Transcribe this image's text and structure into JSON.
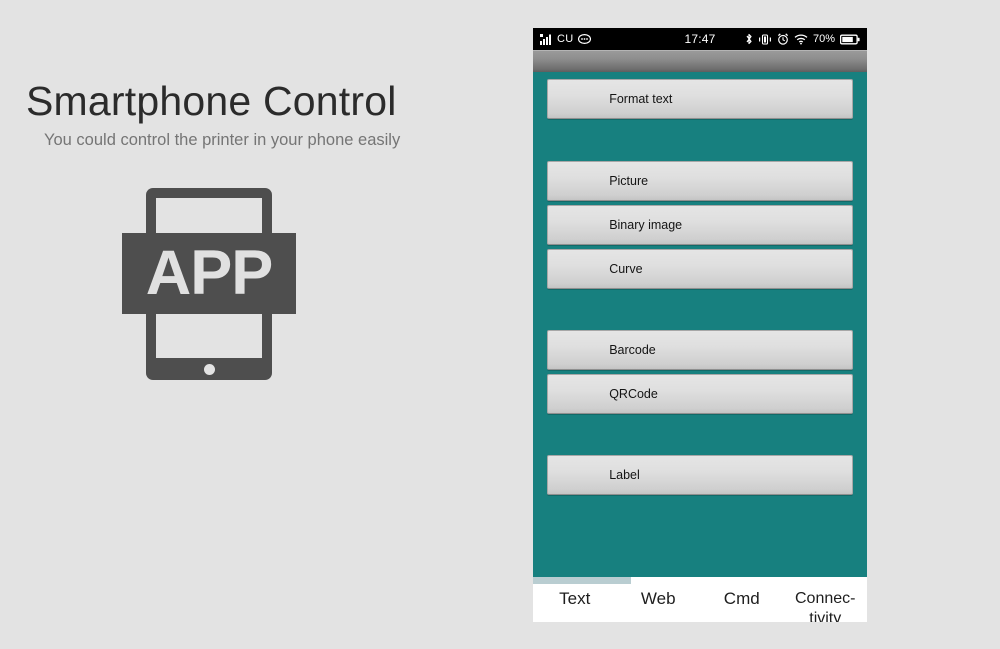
{
  "left": {
    "title": "Smartphone Control",
    "subtitle": "You could control the printer in your phone easily",
    "app_icon_label": "APP"
  },
  "phone": {
    "status_bar": {
      "signal_icon": "signal-bars-icon",
      "carrier": "CU",
      "message_icon": "message-bubble-icon",
      "time": "17:47",
      "bluetooth_icon": "bluetooth-icon",
      "vibrate_icon": "vibrate-icon",
      "alarm_icon": "alarm-clock-icon",
      "wifi_icon": "wifi-icon",
      "battery_percent": "70%",
      "battery_icon": "battery-icon"
    },
    "buttons": [
      {
        "label": "Format text"
      },
      {
        "label": "Picture"
      },
      {
        "label": "Binary image"
      },
      {
        "label": "Curve"
      },
      {
        "label": "Barcode"
      },
      {
        "label": "QRCode"
      },
      {
        "label": "Label"
      }
    ],
    "tabs": [
      {
        "label": "Text",
        "selected": true
      },
      {
        "label": "Web",
        "selected": false
      },
      {
        "label": "Cmd",
        "selected": false
      },
      {
        "label": "Connec-tivity",
        "selected": false
      }
    ]
  },
  "colors": {
    "page_background": "#e3e3e3",
    "teal": "#17807f",
    "button_face": "#dcdcdc",
    "status_bar": "#000000",
    "tab_indicator": "#b9cdd1",
    "icon_gray": "#4e4e4e"
  }
}
